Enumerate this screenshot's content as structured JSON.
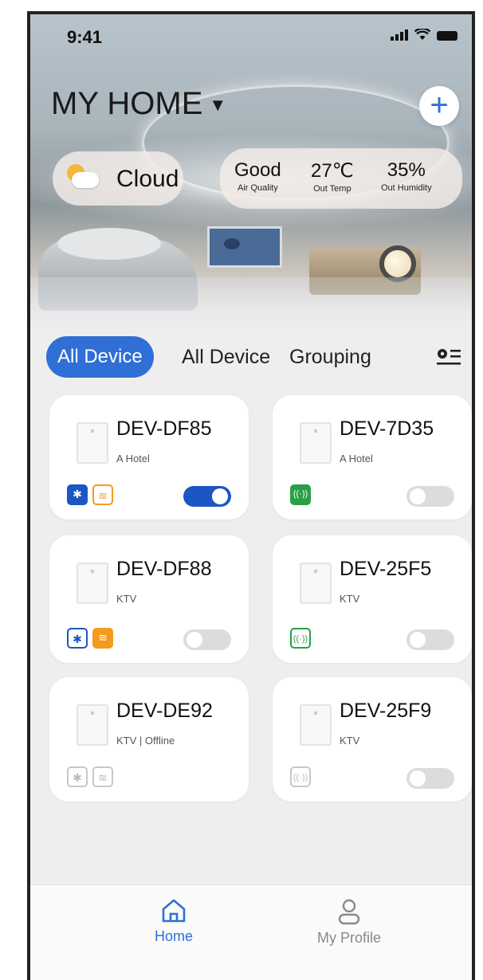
{
  "status_bar": {
    "time": "9:41"
  },
  "header": {
    "title": "MY HOME",
    "add_icon": "plus-icon"
  },
  "weather": {
    "label": "Cloud",
    "icon": "partly-cloudy-icon"
  },
  "stats": [
    {
      "value": "Good",
      "label": "Air Quality"
    },
    {
      "value": "27℃",
      "label": "Out Temp"
    },
    {
      "value": "35%",
      "label": "Out Humidity"
    }
  ],
  "tabs": {
    "active": "All Device",
    "items": [
      "All Device",
      "Grouping"
    ],
    "filter_icon": "settings-list-icon"
  },
  "devices": [
    {
      "name": "DEV-DF85",
      "sub": "A Hotel",
      "icons": [
        "bluetooth-on",
        "wifi-outline"
      ],
      "toggle": "on"
    },
    {
      "name": "DEV-7D35",
      "sub": "A Hotel",
      "icons": [
        "signal-on"
      ],
      "toggle": "off"
    },
    {
      "name": "DEV-DF88",
      "sub": "KTV",
      "icons": [
        "bluetooth-outline",
        "wifi-on"
      ],
      "toggle": "off"
    },
    {
      "name": "DEV-25F5",
      "sub": "KTV",
      "icons": [
        "signal-outline"
      ],
      "toggle": "off"
    },
    {
      "name": "DEV-DE92",
      "sub": "KTV | Offline",
      "icons": [
        "bluetooth-gray",
        "wifi-gray"
      ],
      "toggle": "none"
    },
    {
      "name": "DEV-25F9",
      "sub": "KTV",
      "icons": [
        "signal-gray"
      ],
      "toggle": "off"
    }
  ],
  "nav": {
    "home": "Home",
    "profile": "My Profile"
  },
  "colors": {
    "accent": "#2f6fd6",
    "bluetooth": "#1c56c2",
    "wifi": "#f39a1f",
    "signal": "#27a047"
  }
}
